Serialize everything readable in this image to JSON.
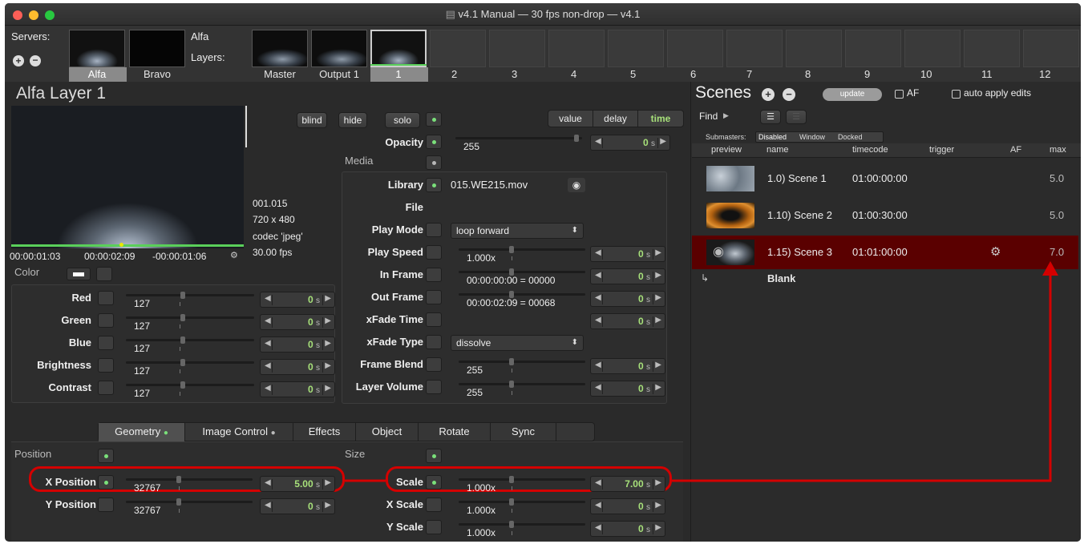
{
  "window": {
    "title": "v4.1 Manual  —  30 fps non-drop  —  v4.1"
  },
  "strip": {
    "servers_label": "Servers:",
    "servers": [
      "Alfa",
      "Bravo"
    ],
    "server_name": "Alfa",
    "layers_label": "Layers:",
    "layer_tabs": [
      "Master",
      "Output 1",
      "1"
    ],
    "layer_numbers": [
      "2",
      "3",
      "4",
      "5",
      "6",
      "7",
      "8",
      "9",
      "10",
      "11",
      "12"
    ]
  },
  "layer": {
    "title": "Alfa Layer 1",
    "buttons": {
      "blind": "blind",
      "hide": "hide",
      "solo": "solo"
    },
    "mode_tabs": [
      "value",
      "delay",
      "time"
    ],
    "active_mode": "time",
    "opacity_label": "Opacity",
    "opacity_value": "255",
    "media_label": "Media",
    "info": {
      "file_id": "001.015",
      "size": "720 x 480",
      "codec": "codec 'jpeg'",
      "fps": "30.00 fps"
    },
    "timecodes": {
      "current": "00:00:01:03",
      "duration": "00:00:02:09",
      "remaining": "-00:00:01:06"
    },
    "color_label": "Color",
    "color_rows": [
      {
        "label": "Red",
        "value": "127",
        "time": "0"
      },
      {
        "label": "Green",
        "value": "127",
        "time": "0"
      },
      {
        "label": "Blue",
        "value": "127",
        "time": "0"
      },
      {
        "label": "Brightness",
        "value": "127",
        "time": "0"
      },
      {
        "label": "Contrast",
        "value": "127",
        "time": "0"
      }
    ],
    "media_rows": {
      "library_label": "Library",
      "library_value": "015.WE215.mov",
      "file_label": "File",
      "playmode_label": "Play Mode",
      "playmode_value": "loop forward",
      "playspeed_label": "Play Speed",
      "playspeed_value": "1.000x",
      "infr_label": "In Frame",
      "infr_value": "00:00:00:00 = 00000",
      "outfr_label": "Out Frame",
      "outfr_value": "00:00:02:09 = 00068",
      "xfadetime_label": "xFade Time",
      "xfadetype_label": "xFade Type",
      "xfadetype_value": "dissolve",
      "frameblend_label": "Frame Blend",
      "frameblend_value": "255",
      "layervol_label": "Layer Volume",
      "layervol_value": "255",
      "time_zero": "0",
      "time_unit": "s"
    },
    "bottom_tabs": [
      "Geometry",
      "Image Control",
      "Effects",
      "Object",
      "Rotate",
      "Sync"
    ],
    "position_label": "Position",
    "size_label": "Size",
    "xpos_label": "X Position",
    "xpos_value": "32767",
    "xpos_time": "5.00",
    "ypos_label": "Y Position",
    "ypos_value": "32767",
    "ypos_time": "0",
    "scale_label": "Scale",
    "scale_value": "1.000x",
    "scale_time": "7.00",
    "xscale_label": "X Scale",
    "xscale_value": "1.000x",
    "xscale_time": "0",
    "yscale_label": "Y Scale",
    "yscale_value": "1.000x",
    "yscale_time": "0"
  },
  "scenes": {
    "title": "Scenes",
    "update_label": "update",
    "af_label": "AF",
    "auto_apply_label": "auto apply edits",
    "find_label": "Find",
    "submasters_label": "Submasters:",
    "sub_tabs": [
      "Disabled",
      "Window",
      "Docked"
    ],
    "columns": [
      "preview",
      "name",
      "timecode",
      "trigger",
      "AF",
      "max"
    ],
    "rows": [
      {
        "name": "1.0) Scene 1",
        "timecode": "01:00:00:00",
        "max": "5.0"
      },
      {
        "name": "1.10) Scene 2",
        "timecode": "01:00:30:00",
        "max": "5.0"
      },
      {
        "name": "1.15) Scene 3",
        "timecode": "01:01:00:00",
        "max": "7.0"
      }
    ],
    "blank_label": "Blank"
  },
  "colors": {
    "accent_green": "#7ae07a",
    "selected_row": "#5a0000",
    "highlight": "#d40000"
  }
}
